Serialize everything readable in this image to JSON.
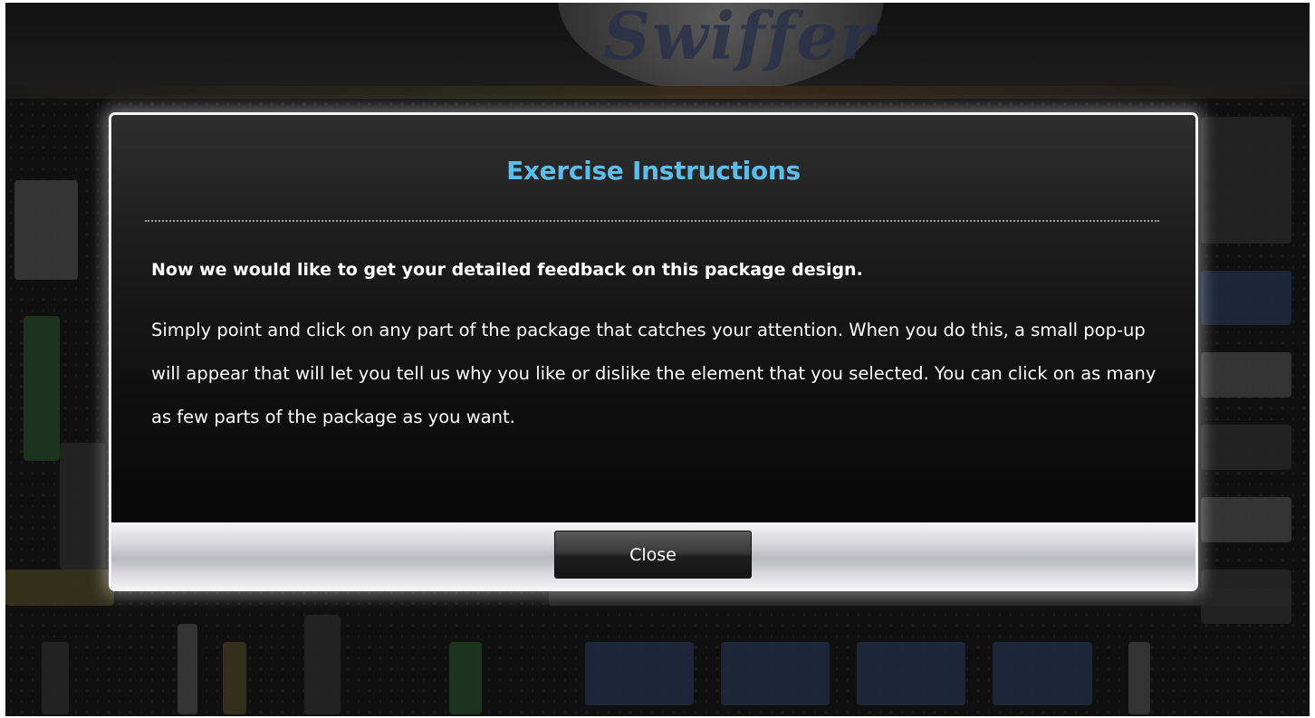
{
  "background": {
    "brand_logo_text": "Swiffer"
  },
  "modal": {
    "title": "Exercise Instructions",
    "lead": "Now we would like to get your detailed feedback on this package design.",
    "body": "Simply point and click on any part of the package that catches your attention. When you do this, a small pop-up will appear that will let you tell us why you like or dislike the element that you selected. You can click on as many as few parts of the package as you want.",
    "close_label": "Close"
  },
  "colors": {
    "title_accent": "#5dbde8",
    "modal_border": "#f4f4f4"
  }
}
